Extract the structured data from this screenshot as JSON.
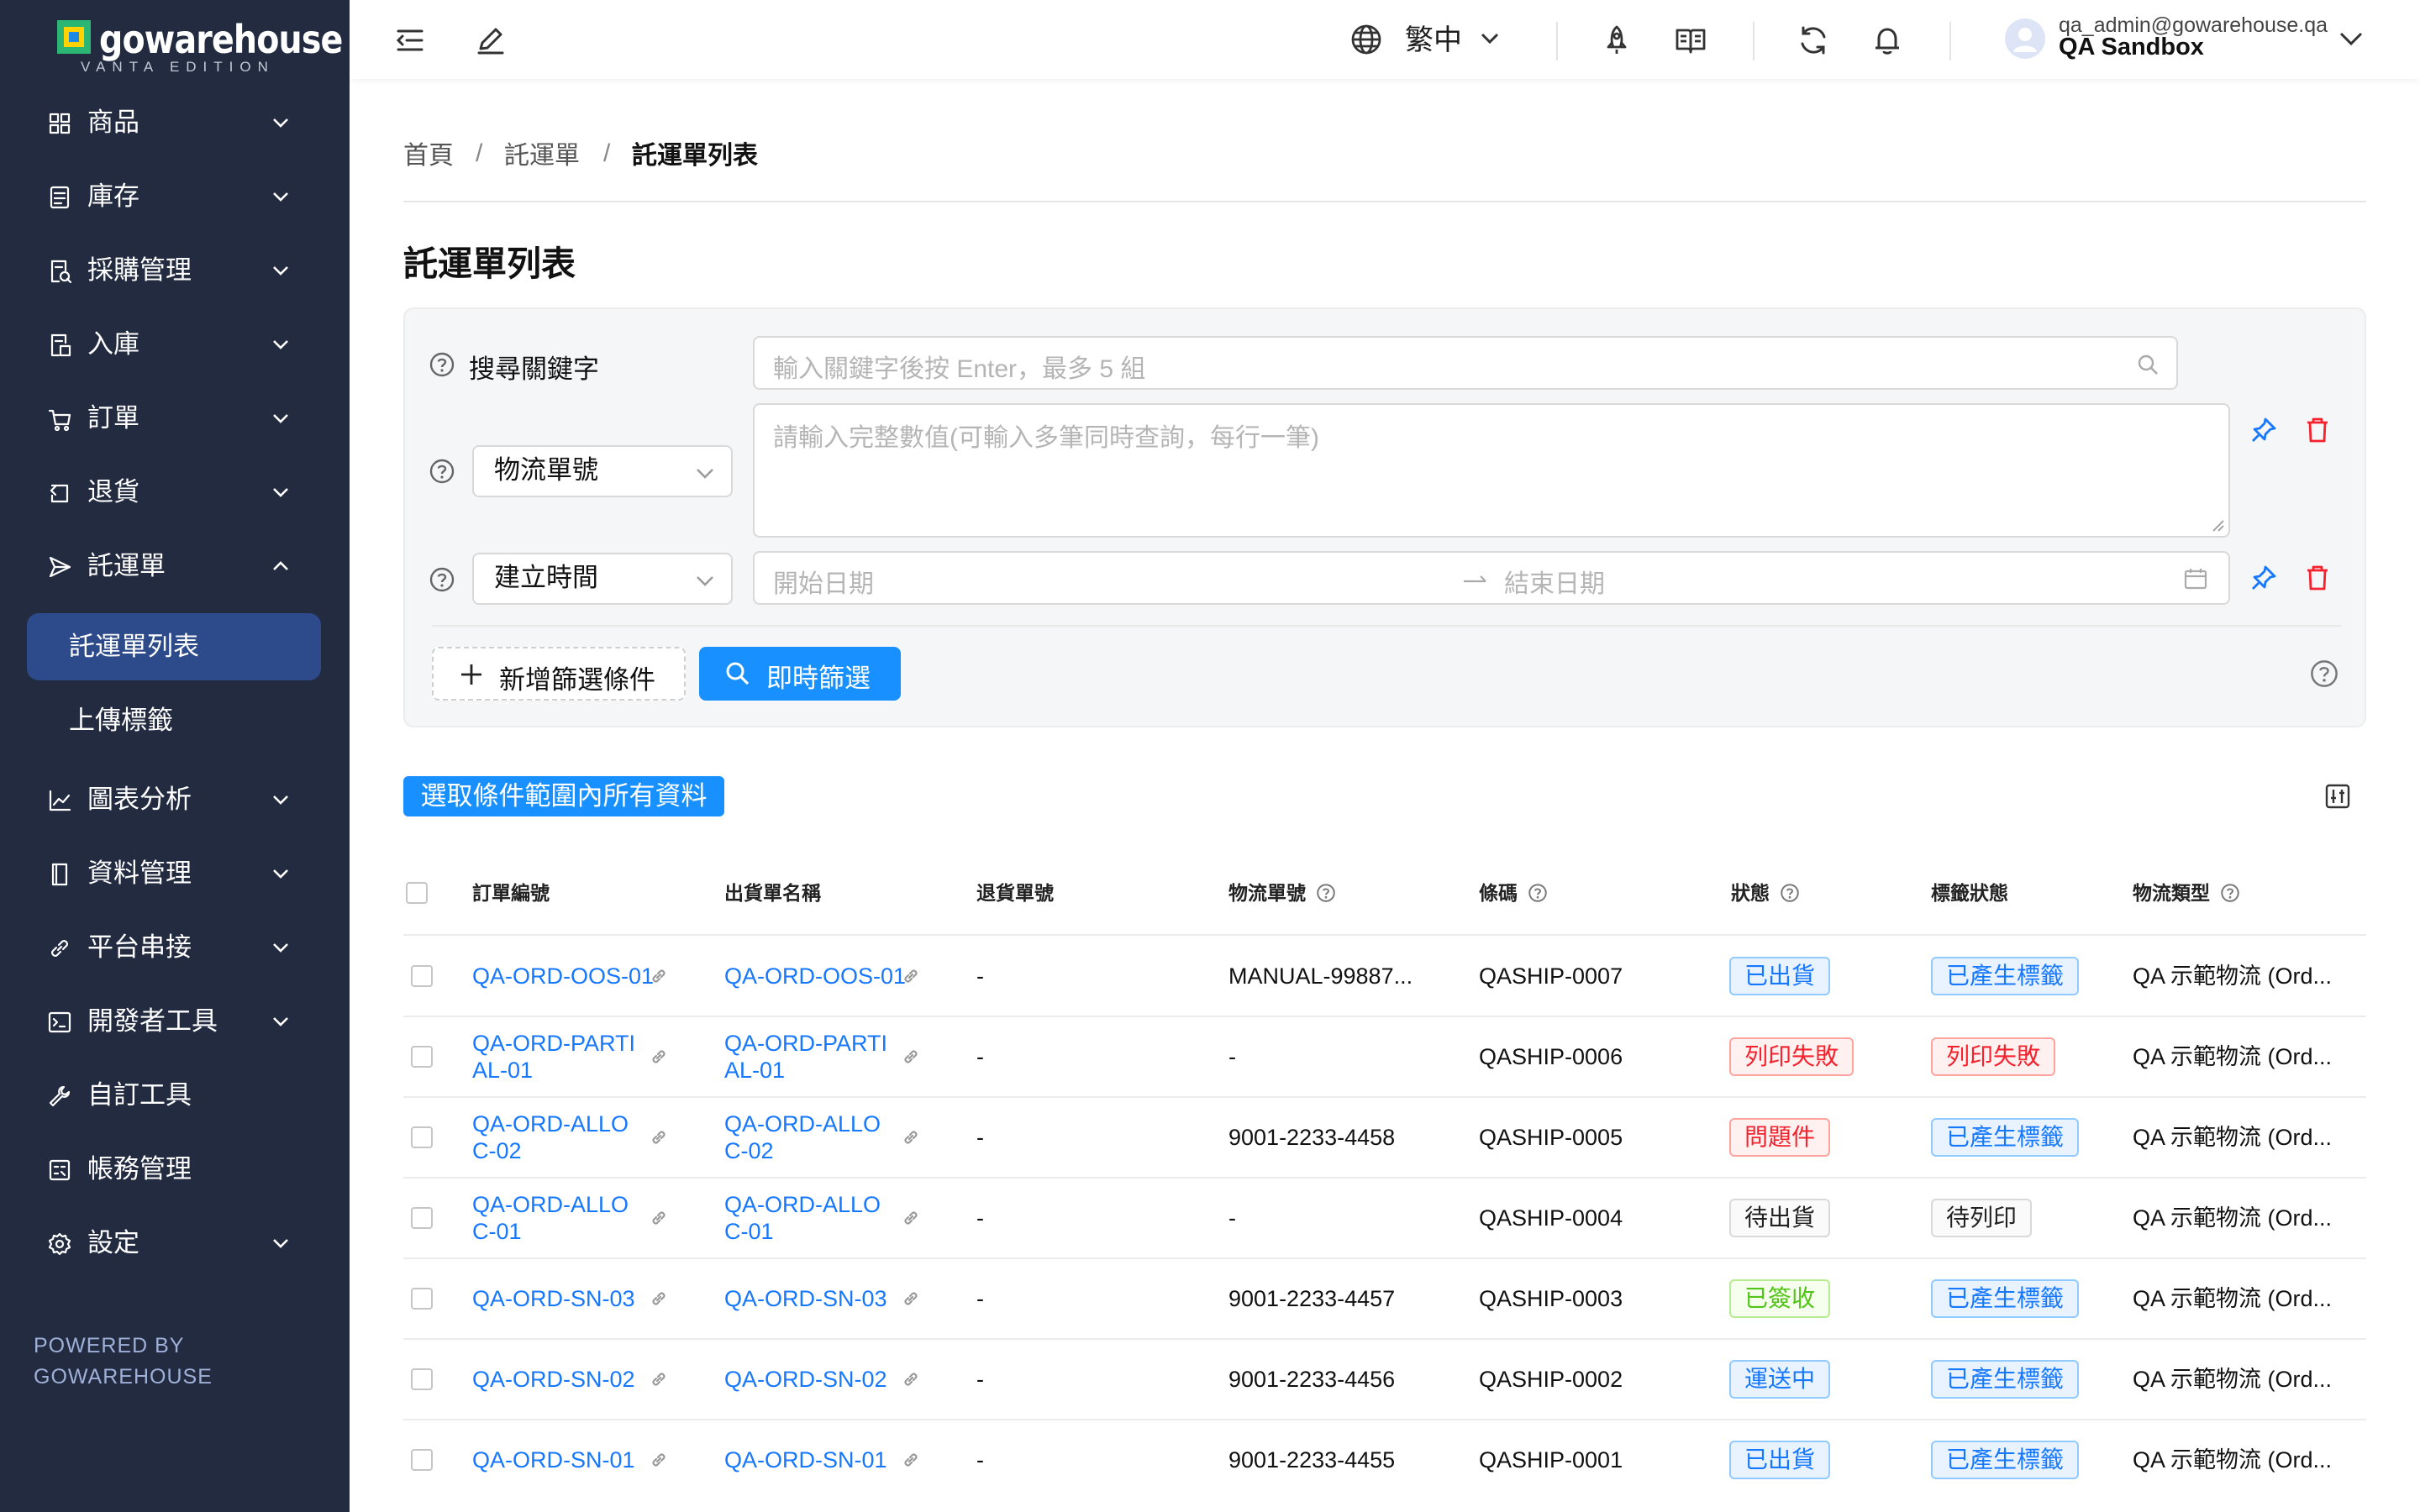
{
  "brand": {
    "name": "gowarehouse",
    "edition": "VANTA EDITION",
    "powered_by": "POWERED BY GOWAREHOUSE"
  },
  "sidebar": {
    "items": [
      {
        "label": "商品",
        "icon": "grid-icon"
      },
      {
        "label": "庫存",
        "icon": "inventory-icon"
      },
      {
        "label": "採購管理",
        "icon": "purchase-icon"
      },
      {
        "label": "入庫",
        "icon": "inbound-icon"
      },
      {
        "label": "訂單",
        "icon": "cart-icon"
      },
      {
        "label": "退貨",
        "icon": "return-icon"
      },
      {
        "label": "託運單",
        "icon": "send-icon"
      },
      {
        "label": "圖表分析",
        "icon": "chart-icon"
      },
      {
        "label": "資料管理",
        "icon": "data-icon"
      },
      {
        "label": "平台串接",
        "icon": "link-icon"
      },
      {
        "label": "開發者工具",
        "icon": "terminal-icon"
      },
      {
        "label": "自訂工具",
        "icon": "wrench-icon"
      },
      {
        "label": "帳務管理",
        "icon": "billing-icon"
      },
      {
        "label": "設定",
        "icon": "gear-icon"
      }
    ],
    "sub_items": [
      {
        "label": "託運單列表"
      },
      {
        "label": "上傳標籤"
      }
    ]
  },
  "header": {
    "language": "繁中",
    "user_email": "qa_admin@gowarehouse.qa",
    "org": "QA Sandbox"
  },
  "breadcrumb": {
    "home": "首頁",
    "section": "託運單",
    "current": "託運單列表",
    "sep": "/"
  },
  "page_title": "託運單列表",
  "filters": {
    "keyword_label": "搜尋關鍵字",
    "keyword_placeholder": "輸入關鍵字後按 Enter，最多 5 組",
    "field1_select": "物流單號",
    "field1_placeholder": "請輸入完整數值(可輸入多筆同時查詢，每行一筆)",
    "field2_select": "建立時間",
    "start_placeholder": "開始日期",
    "end_placeholder": "結束日期",
    "add_condition": "新增篩選條件",
    "apply": "即時篩選"
  },
  "select_all_button": "選取條件範圍內所有資料",
  "table": {
    "columns": [
      "訂單編號",
      "出貨單名稱",
      "退貨單號",
      "物流單號",
      "條碼",
      "狀態",
      "標籤狀態",
      "物流類型"
    ],
    "rows": [
      {
        "order": "QA-ORD-OOS-01",
        "shipment": "QA-ORD-OOS-01",
        "return": "-",
        "tracking": "MANUAL-99887...",
        "barcode": "QASHIP-0007",
        "status": "已出貨",
        "status_color": "blue",
        "label": "已產生標籤",
        "label_color": "blue",
        "type": "QA 示範物流 (Ord..."
      },
      {
        "order": "QA-ORD-PARTIAL-01",
        "shipment": "QA-ORD-PARTIAL-01",
        "return": "-",
        "tracking": "-",
        "barcode": "QASHIP-0006",
        "status": "列印失敗",
        "status_color": "red",
        "label": "列印失敗",
        "label_color": "red",
        "type": "QA 示範物流 (Ord..."
      },
      {
        "order": "QA-ORD-ALLOC-02",
        "shipment": "QA-ORD-ALLOC-02",
        "return": "-",
        "tracking": "9001-2233-4458",
        "barcode": "QASHIP-0005",
        "status": "問題件",
        "status_color": "red",
        "label": "已產生標籤",
        "label_color": "blue",
        "type": "QA 示範物流 (Ord..."
      },
      {
        "order": "QA-ORD-ALLOC-01",
        "shipment": "QA-ORD-ALLOC-01",
        "return": "-",
        "tracking": "-",
        "barcode": "QASHIP-0004",
        "status": "待出貨",
        "status_color": "gray",
        "label": "待列印",
        "label_color": "gray",
        "type": "QA 示範物流 (Ord..."
      },
      {
        "order": "QA-ORD-SN-03",
        "shipment": "QA-ORD-SN-03",
        "return": "-",
        "tracking": "9001-2233-4457",
        "barcode": "QASHIP-0003",
        "status": "已簽收",
        "status_color": "green",
        "label": "已產生標籤",
        "label_color": "blue",
        "type": "QA 示範物流 (Ord..."
      },
      {
        "order": "QA-ORD-SN-02",
        "shipment": "QA-ORD-SN-02",
        "return": "-",
        "tracking": "9001-2233-4456",
        "barcode": "QASHIP-0002",
        "status": "運送中",
        "status_color": "blue",
        "label": "已產生標籤",
        "label_color": "blue",
        "type": "QA 示範物流 (Ord..."
      },
      {
        "order": "QA-ORD-SN-01",
        "shipment": "QA-ORD-SN-01",
        "return": "-",
        "tracking": "9001-2233-4455",
        "barcode": "QASHIP-0001",
        "status": "已出貨",
        "status_color": "blue",
        "label": "已產生標籤",
        "label_color": "blue",
        "type": "QA 示範物流 (Ord..."
      }
    ]
  }
}
